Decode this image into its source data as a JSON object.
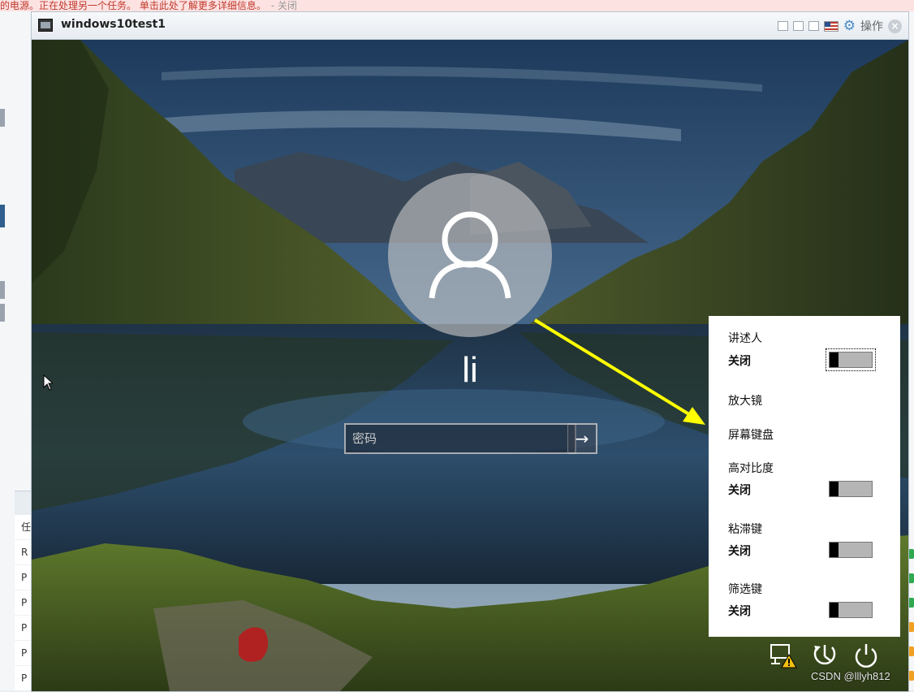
{
  "notice": {
    "text": "的电源。正在处理另一个任务。 单击此处了解更多详细信息。",
    "close": "- 关闭"
  },
  "host": {
    "task_column": [
      "任",
      "R",
      "P",
      "P",
      "P",
      "P",
      "P"
    ]
  },
  "vm_window": {
    "title": "windows10test1",
    "actions_label": "操作",
    "close_glyph": "×"
  },
  "lock_screen": {
    "username": "li",
    "password_placeholder": "密码",
    "submit_glyph": "→"
  },
  "accessibility": {
    "items": [
      {
        "label": "讲述人",
        "state": "关闭",
        "has_toggle": true
      },
      {
        "label": "放大镜",
        "state": "",
        "has_toggle": false
      },
      {
        "label": "屏幕键盘",
        "state": "",
        "has_toggle": false
      },
      {
        "label": "高对比度",
        "state": "关闭",
        "has_toggle": true
      },
      {
        "label": "粘滞键",
        "state": "关闭",
        "has_toggle": true
      },
      {
        "label": "筛选键",
        "state": "关闭",
        "has_toggle": true
      }
    ]
  },
  "tray_icons": [
    "network-warning-icon",
    "ease-of-access-icon",
    "power-icon"
  ],
  "watermark": "CSDN @lllyh812",
  "colors": {
    "annotation_arrow": "#ffff00",
    "notice_text": "#c0392b"
  }
}
